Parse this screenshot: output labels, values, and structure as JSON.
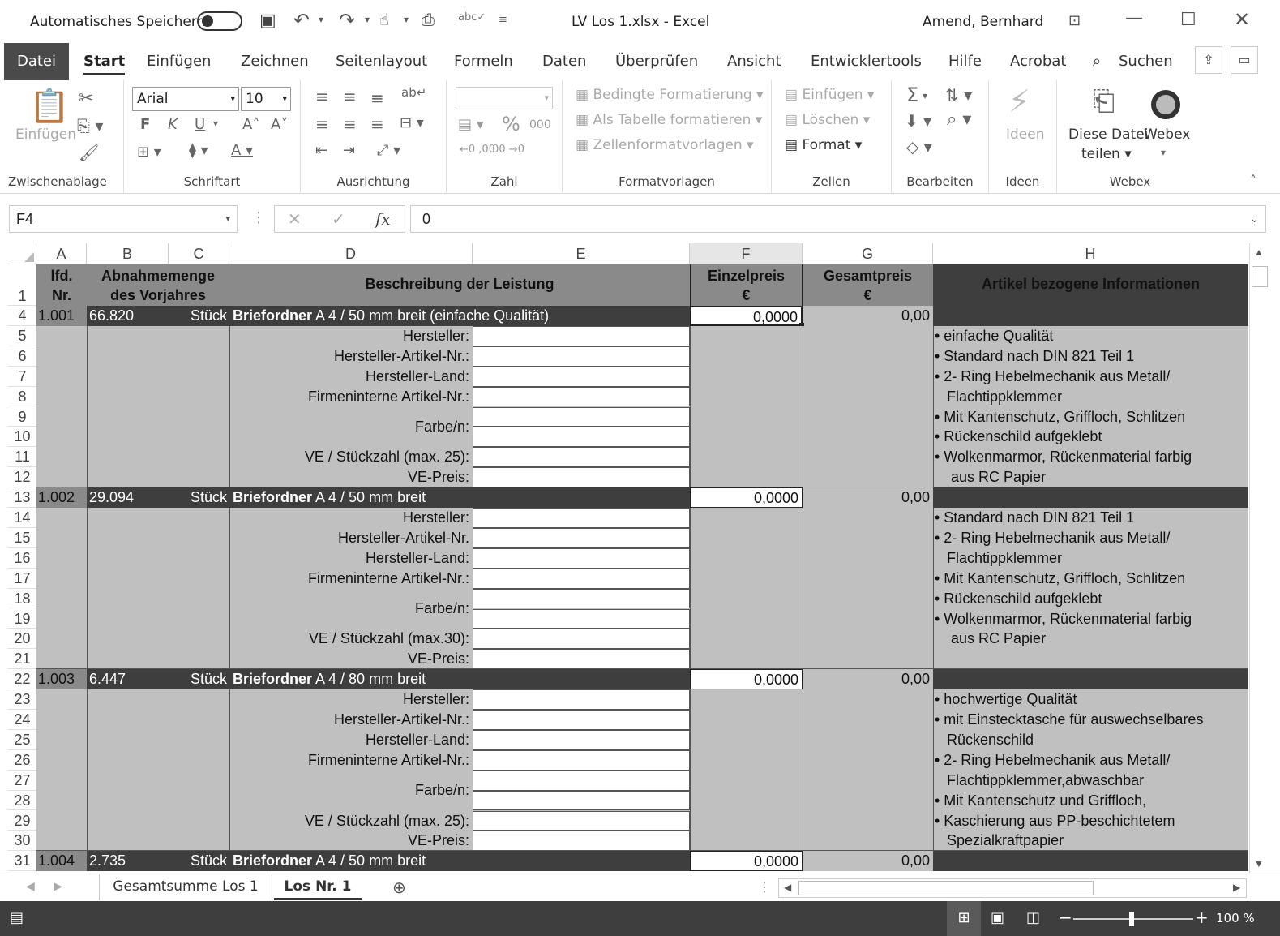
{
  "titlebar": {
    "autosave": "Automatisches Speichern",
    "doc_title": "LV Los 1.xlsx  -  Excel",
    "user": "Amend, Bernhard"
  },
  "tabs": {
    "file": "Datei",
    "items": [
      "Start",
      "Einfügen",
      "Zeichnen",
      "Seitenlayout",
      "Formeln",
      "Daten",
      "Überprüfen",
      "Ansicht",
      "Entwicklertools",
      "Hilfe",
      "Acrobat"
    ],
    "search": "Suchen"
  },
  "ribbon": {
    "clipboard": {
      "paste": "Einfügen",
      "label": "Zwischenablage"
    },
    "font": {
      "name": "Arial",
      "size": "10",
      "bold": "F",
      "italic": "K",
      "underline": "U",
      "label": "Schriftart"
    },
    "alignment": {
      "label": "Ausrichtung"
    },
    "number": {
      "label": "Zahl"
    },
    "styles": {
      "cond": "Bedingte Formatierung",
      "table": "Als Tabelle formatieren",
      "cell": "Zellenformatvorlagen",
      "label": "Formatvorlagen"
    },
    "cells": {
      "insert": "Einfügen",
      "delete": "Löschen",
      "format": "Format",
      "label": "Zellen"
    },
    "editing": {
      "label": "Bearbeiten"
    },
    "ideas": {
      "btn": "Ideen",
      "label": "Ideen"
    },
    "webex": {
      "share1": "Diese Datei",
      "share2": "teilen",
      "webex": "Webex",
      "label": "Webex"
    }
  },
  "formula": {
    "namebox": "F4",
    "value": "0"
  },
  "columns": [
    "A",
    "B",
    "C",
    "D",
    "E",
    "F",
    "G",
    "H"
  ],
  "header": {
    "lfd": "lfd.",
    "nr": "Nr.",
    "abnahme1": "Abnahmemenge",
    "abnahme2": "des Vorjahres",
    "beschreibung": "Beschreibung der Leistung",
    "einzel": "Einzelpreis",
    "gesamt": "Gesamtpreis",
    "euro": "€",
    "artikel": "Artikel bezogene Informationen"
  },
  "rows": [
    "1",
    "4",
    "5",
    "6",
    "7",
    "8",
    "9",
    "10",
    "11",
    "12",
    "13",
    "14",
    "15",
    "16",
    "17",
    "18",
    "19",
    "20",
    "21",
    "22",
    "23",
    "24",
    "25",
    "26",
    "27",
    "28",
    "29",
    "30",
    "31"
  ],
  "items": [
    {
      "nr": "1.001",
      "qty": "66.820",
      "unit": "Stück",
      "title_bold": "Briefordner",
      "title_rest": " A 4 / 50 mm breit (einfache Qualität)",
      "einzel": "0,0000",
      "gesamt": "0,00",
      "labels": [
        "Hersteller:",
        "Hersteller-Artikel-Nr.:",
        "Hersteller-Land:",
        "Firmeninterne Artikel-Nr.:",
        "Farbe/n:",
        "VE / Stückzahl (max. 25):",
        "VE-Preis:"
      ],
      "info": [
        "• einfache Qualität",
        "• Standard nach DIN 821 Teil 1",
        "• 2- Ring Hebelmechanik aus Metall/",
        "   Flachtippklemmer",
        "• Mit Kantenschutz, Griffloch, Schlitzen",
        "• Rückenschild aufgeklebt",
        "• Wolkenmarmor, Rückenmaterial farbig",
        "    aus RC Papier"
      ]
    },
    {
      "nr": "1.002",
      "qty": "29.094",
      "unit": "Stück",
      "title_bold": "Briefordner",
      "title_rest": " A 4 / 50 mm breit",
      "einzel": "0,0000",
      "gesamt": "0,00",
      "labels": [
        "Hersteller:",
        "Hersteller-Artikel-Nr.",
        "Hersteller-Land:",
        "Firmeninterne Artikel-Nr.:",
        "Farbe/n:",
        "VE / Stückzahl (max.30):",
        "VE-Preis:"
      ],
      "info": [
        "• Standard nach DIN 821 Teil 1",
        "• 2- Ring Hebelmechanik aus Metall/",
        "   Flachtippklemmer",
        "• Mit Kantenschutz, Griffloch, Schlitzen",
        "• Rückenschild aufgeklebt",
        "• Wolkenmarmor, Rückenmaterial farbig",
        "    aus RC Papier"
      ]
    },
    {
      "nr": "1.003",
      "qty": "6.447",
      "unit": "Stück",
      "title_bold": "Briefordner",
      "title_rest": " A 4 / 80 mm breit",
      "einzel": "0,0000",
      "gesamt": "0,00",
      "labels": [
        "Hersteller:",
        "Hersteller-Artikel-Nr.:",
        "Hersteller-Land:",
        "Firmeninterne Artikel-Nr.:",
        "Farbe/n:",
        "VE / Stückzahl (max. 25):",
        "VE-Preis:"
      ],
      "info": [
        "• hochwertige Qualität",
        "• mit Einstecktasche für auswechselbares",
        "   Rückenschild",
        "• 2- Ring Hebelmechanik aus Metall/",
        "   Flachtippklemmer,abwaschbar",
        "• Mit Kantenschutz und Griffloch,",
        "• Kaschierung aus PP-beschichtetem",
        "   Spezialkraftpapier"
      ]
    },
    {
      "nr": "1.004",
      "qty": "2.735",
      "unit": "Stück",
      "title_bold": "Briefordner",
      "title_rest": " A 4 / 50 mm breit",
      "einzel": "0,0000",
      "gesamt": "0,00",
      "labels": [],
      "info": []
    }
  ],
  "sheettabs": {
    "tab1": "Gesamtsumme Los 1",
    "tab2": "Los Nr. 1"
  },
  "status": {
    "zoom": "100 %"
  }
}
